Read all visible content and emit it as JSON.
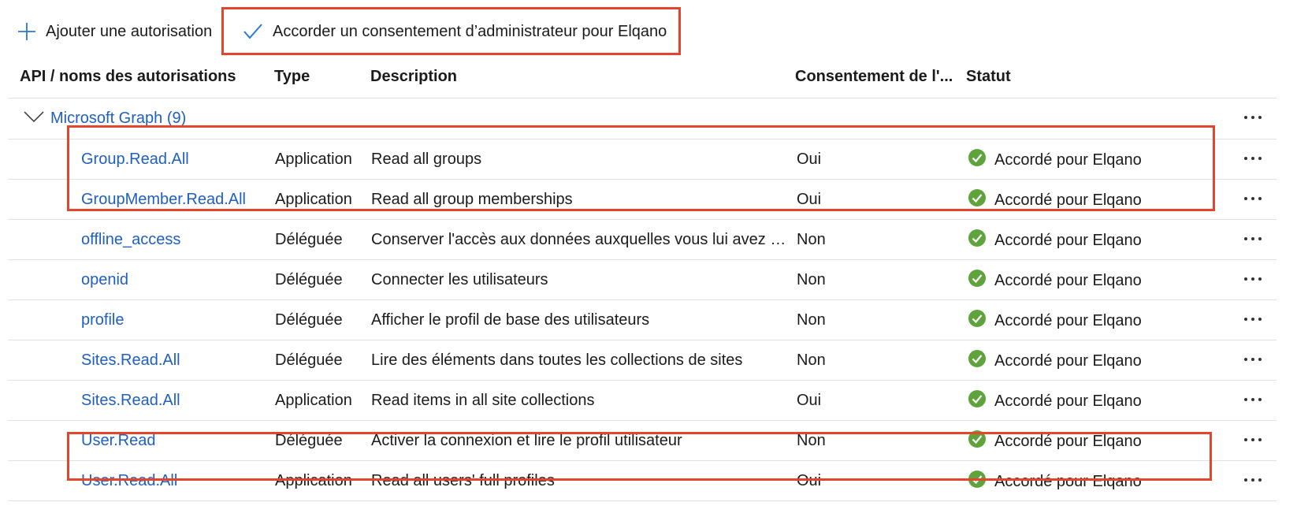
{
  "toolbar": {
    "add_label": "Ajouter une autorisation",
    "grant_label": "Accorder un consentement d’administrateur pour Elqano"
  },
  "table": {
    "headers": {
      "name": "API / noms des autorisations",
      "type": "Type",
      "description": "Description",
      "consent": "Consentement de l'...",
      "status": "Statut"
    },
    "group": {
      "label": "Microsoft Graph (9)"
    },
    "rows": [
      {
        "name": "Group.Read.All",
        "type": "Application",
        "description": "Read all groups",
        "consent": "Oui",
        "status": "Accordé pour Elqano"
      },
      {
        "name": "GroupMember.Read.All",
        "type": "Application",
        "description": "Read all group memberships",
        "consent": "Oui",
        "status": "Accordé pour Elqano"
      },
      {
        "name": "offline_access",
        "type": "Déléguée",
        "description": "Conserver l'accès aux données auxquelles vous lui avez do...",
        "consent": "Non",
        "status": "Accordé pour Elqano"
      },
      {
        "name": "openid",
        "type": "Déléguée",
        "description": "Connecter les utilisateurs",
        "consent": "Non",
        "status": "Accordé pour Elqano"
      },
      {
        "name": "profile",
        "type": "Déléguée",
        "description": "Afficher le profil de base des utilisateurs",
        "consent": "Non",
        "status": "Accordé pour Elqano"
      },
      {
        "name": "Sites.Read.All",
        "type": "Déléguée",
        "description": "Lire des éléments dans toutes les collections de sites",
        "consent": "Non",
        "status": "Accordé pour Elqano"
      },
      {
        "name": "Sites.Read.All",
        "type": "Application",
        "description": "Read items in all site collections",
        "consent": "Oui",
        "status": "Accordé pour Elqano"
      },
      {
        "name": "User.Read",
        "type": "Déléguée",
        "description": "Activer la connexion et lire le profil utilisateur",
        "consent": "Non",
        "status": "Accordé pour Elqano"
      },
      {
        "name": "User.Read.All",
        "type": "Application",
        "description": "Read all users' full profiles",
        "consent": "Oui",
        "status": "Accordé pour Elqano"
      }
    ]
  },
  "colors": {
    "link": "#1f5fbf",
    "accent_icon": "#2b78d0",
    "granted": "#5ea33c",
    "highlight": "#e2472e"
  },
  "icons": {
    "add": "plus-icon",
    "grant": "checkmark-icon",
    "group_toggle": "chevron-down-icon",
    "status": "granted-check-circle-icon",
    "row_menu": "more-options-icon"
  }
}
